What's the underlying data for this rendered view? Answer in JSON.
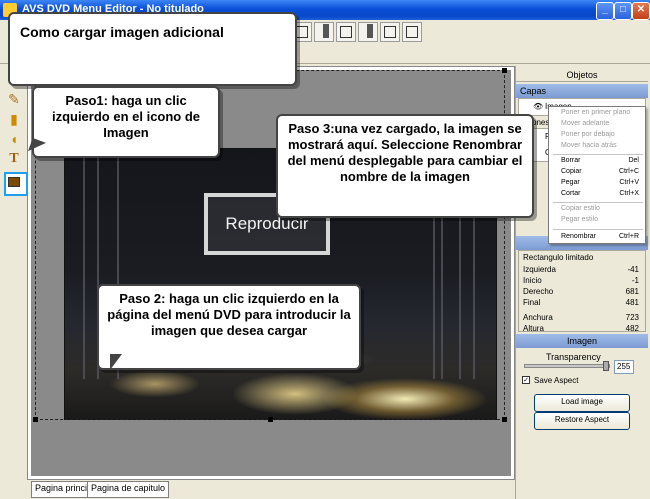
{
  "window": {
    "title": "AVS DVD Menu Editor - No titulado",
    "controls": [
      "minimize",
      "maximize",
      "close"
    ]
  },
  "callouts": {
    "title": "Como cargar imagen adicional",
    "step1": "Paso1: haga un clic izquierdo en el icono de Imagen",
    "step2": "Paso 2: haga un clic izquierdo en la página del menú DVD para introducir la imagen que desea cargar",
    "step3": "Paso 3:una vez cargado, la imagen se mostrará aquí. Seleccione Renombrar del menú desplegable para cambiar el nombre de la imagen"
  },
  "canvas": {
    "button_label": "Reproducir"
  },
  "tabs": [
    "Pagina principal",
    "Pagina de capitulo"
  ],
  "objects_panel": {
    "header": "Objetos",
    "capas_label": "Capas",
    "layer_item": "Imagen",
    "botones_label": "Botones",
    "button_item_1": "Re",
    "button_item_2": "Ca"
  },
  "context_menu": {
    "items": [
      {
        "label": "Poner en primer plano",
        "shortcut": "",
        "disabled": true
      },
      {
        "label": "Mover adelante",
        "shortcut": "",
        "disabled": true
      },
      {
        "label": "Poner por debajo",
        "shortcut": "",
        "disabled": true
      },
      {
        "label": "Mover hacia atrás",
        "shortcut": "",
        "disabled": true
      },
      {
        "label": "Borrar",
        "shortcut": "Del",
        "disabled": false
      },
      {
        "label": "Copiar",
        "shortcut": "Ctrl+C",
        "disabled": false
      },
      {
        "label": "Pegar",
        "shortcut": "Ctrl+V",
        "disabled": false
      },
      {
        "label": "Cortar",
        "shortcut": "Ctrl+X",
        "disabled": false
      },
      {
        "label": "Copiar estilo",
        "shortcut": "",
        "disabled": true
      },
      {
        "label": "Pegar estilo",
        "shortcut": "",
        "disabled": true
      },
      {
        "label": "Renombrar",
        "shortcut": "Ctrl+R",
        "disabled": false
      }
    ]
  },
  "bounds_panel": {
    "title": "Rectangulo limitado",
    "rows": [
      {
        "label": "Izquierda",
        "value": "-41"
      },
      {
        "label": "Inicio",
        "value": "-1"
      },
      {
        "label": "Derecho",
        "value": "681"
      },
      {
        "label": "Final",
        "value": "481"
      },
      {
        "label": "Anchura",
        "value": "723"
      },
      {
        "label": "Altura",
        "value": "482"
      }
    ]
  },
  "image_panel": {
    "header": "Imagen",
    "transparency_label": "Transparency",
    "transparency_value": "255",
    "transparency_fraction": 1.0,
    "save_aspect_label": "Save Aspect",
    "save_aspect_checked": true,
    "load_button": "Load image",
    "restore_button": "Restore Aspect"
  },
  "colors": {
    "titlebar": "#0a4fd8",
    "panel_header": "#9fbbe8",
    "highlight_tool": "#1ea0f0"
  }
}
